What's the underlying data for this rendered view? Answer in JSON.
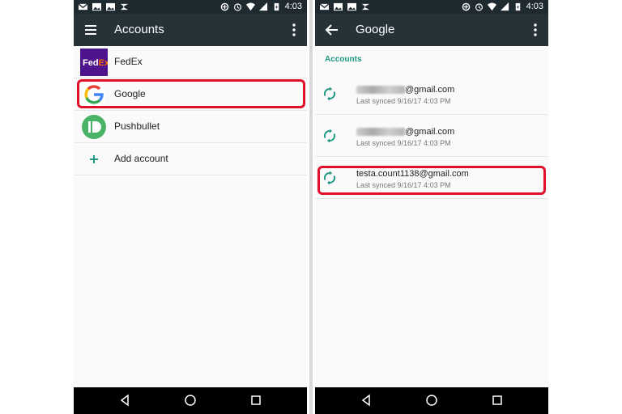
{
  "status": {
    "time": "4:03"
  },
  "left_screen": {
    "title": "Accounts",
    "items": [
      {
        "label": "FedEx",
        "icon": "fedex-logo"
      },
      {
        "label": "Google",
        "icon": "google-logo"
      },
      {
        "label": "Pushbullet",
        "icon": "pushbullet-logo"
      },
      {
        "label": "Add account",
        "icon": "plus-icon"
      }
    ],
    "fedex_logo_text": "FedEx"
  },
  "right_screen": {
    "title": "Google",
    "section_header": "Accounts",
    "accounts": [
      {
        "email_visible": "@gmail.com",
        "synced": "Last synced 9/16/17 4:03 PM"
      },
      {
        "email_visible": "@gmail.com",
        "synced": "Last synced 9/16/17 4:03 PM"
      },
      {
        "email_visible": "testa.count1138@gmail.com",
        "synced": "Last synced 9/16/17 4:03 PM"
      }
    ]
  },
  "colors": {
    "app_bar": "#263238",
    "status_bar": "#1f2a30",
    "accent": "#1e9a82",
    "highlight": "#e0102a"
  }
}
